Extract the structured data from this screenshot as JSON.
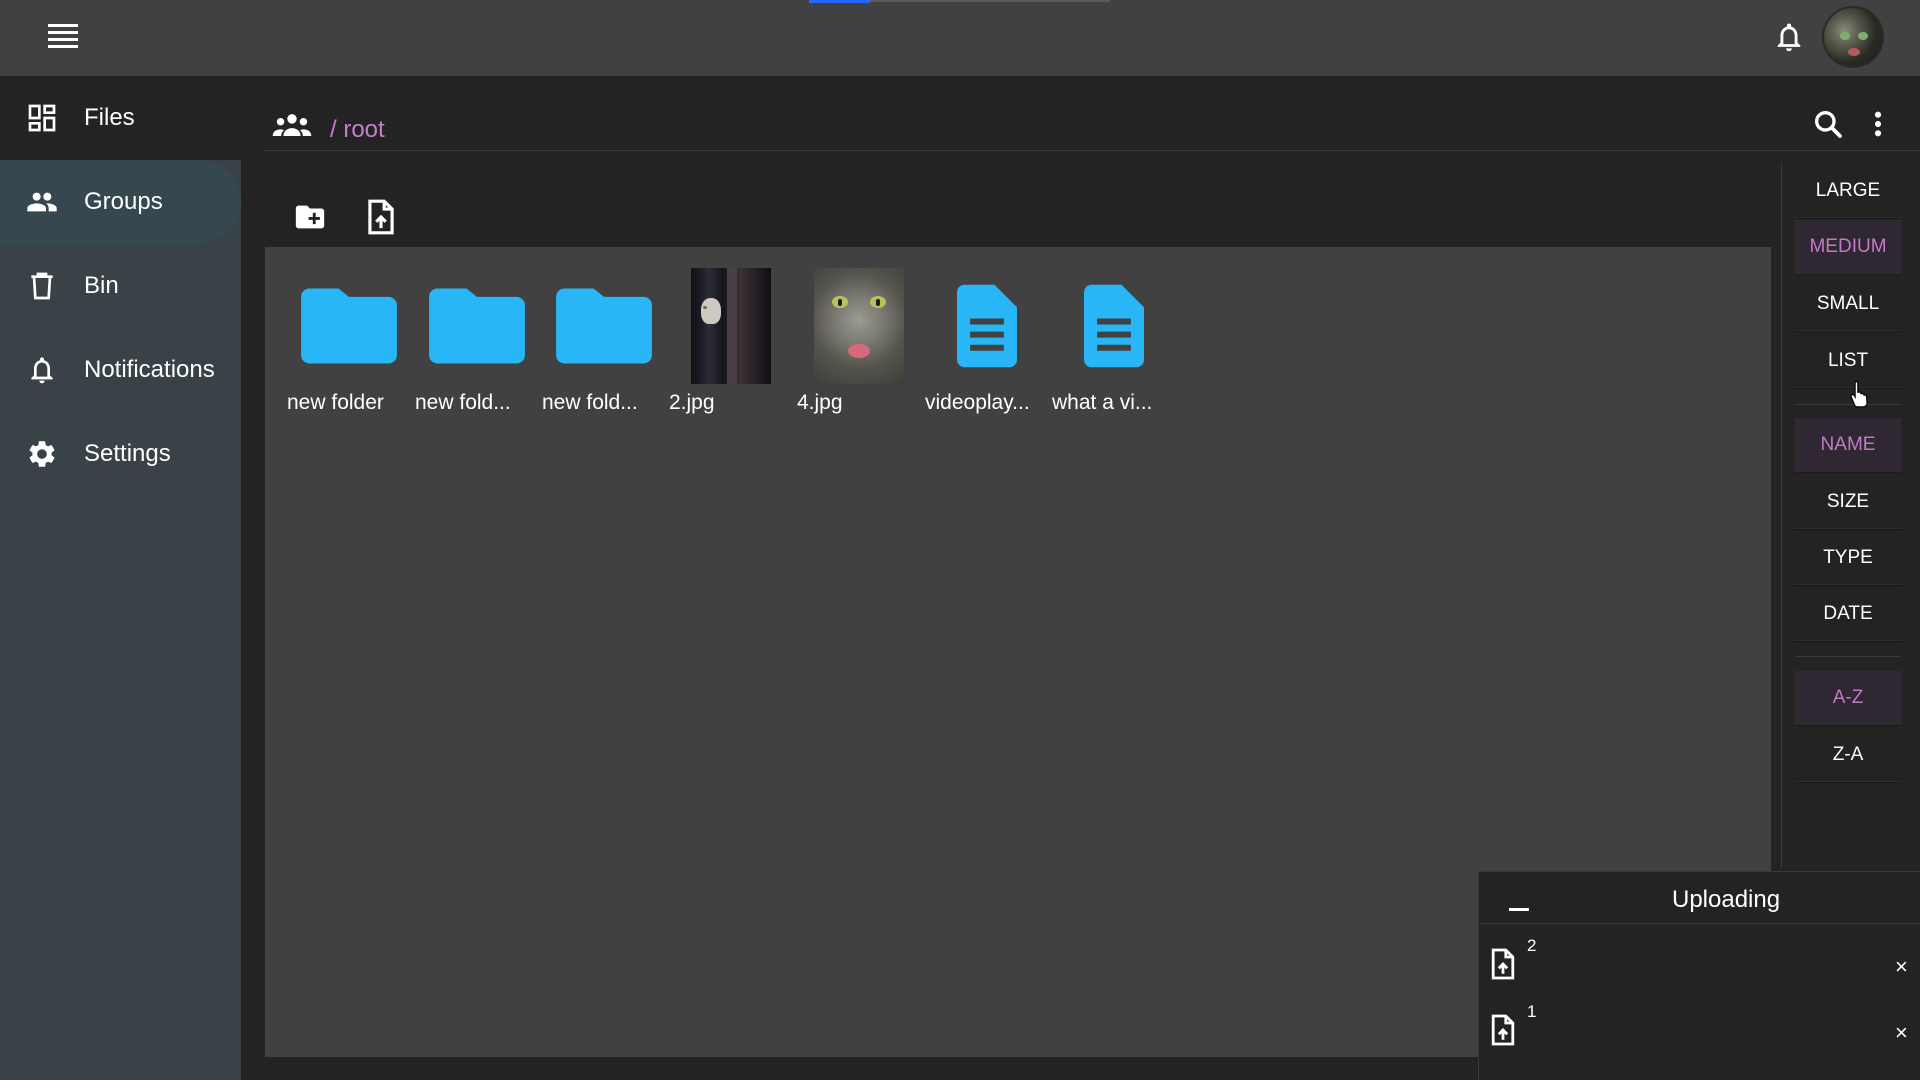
{
  "topbar": {
    "menu_icon": "hamburger-menu-icon",
    "notification_icon": "bell-icon",
    "avatar": "user-avatar"
  },
  "sidebar": {
    "items": [
      {
        "label": "Files",
        "icon": "dashboard-grid-icon"
      },
      {
        "label": "Groups",
        "icon": "people-icon"
      },
      {
        "label": "Bin",
        "icon": "trash-icon"
      },
      {
        "label": "Notifications",
        "icon": "bell-icon"
      },
      {
        "label": "Settings",
        "icon": "gear-icon"
      }
    ]
  },
  "header": {
    "breadcrumb": "/ root",
    "group_icon": "people-icon",
    "search_icon": "search-icon",
    "more_icon": "more-vert-icon"
  },
  "toolbar": {
    "new_folder_icon": "create-folder-icon",
    "upload_file_icon": "upload-file-icon"
  },
  "files": [
    {
      "name": "new folder",
      "type": "folder"
    },
    {
      "name": "new fold...",
      "type": "folder"
    },
    {
      "name": "new fold...",
      "type": "folder"
    },
    {
      "name": "2.jpg",
      "type": "image"
    },
    {
      "name": "4.jpg",
      "type": "image"
    },
    {
      "name": "videoplay...",
      "type": "document"
    },
    {
      "name": "what a vi...",
      "type": "document"
    }
  ],
  "view_options": {
    "sizes": [
      "LARGE",
      "MEDIUM",
      "SMALL",
      "LIST"
    ],
    "active_size": "MEDIUM",
    "sort_by": [
      "NAME",
      "SIZE",
      "TYPE",
      "DATE"
    ],
    "active_sort": "NAME",
    "order": [
      "A-Z",
      "Z-A"
    ],
    "active_order": "A-Z"
  },
  "upload_panel": {
    "title": "Uploading",
    "minimize_icon": "minimize-icon",
    "items": [
      {
        "count": "2",
        "icon": "upload-file-icon",
        "close": "×"
      },
      {
        "count": "1",
        "icon": "upload-file-icon",
        "close": "×"
      }
    ]
  },
  "colors": {
    "accent": "#c27ac8",
    "folder_blue": "#29b6f6",
    "sidebar_bg": "#394247",
    "topbar_bg": "#414141"
  }
}
